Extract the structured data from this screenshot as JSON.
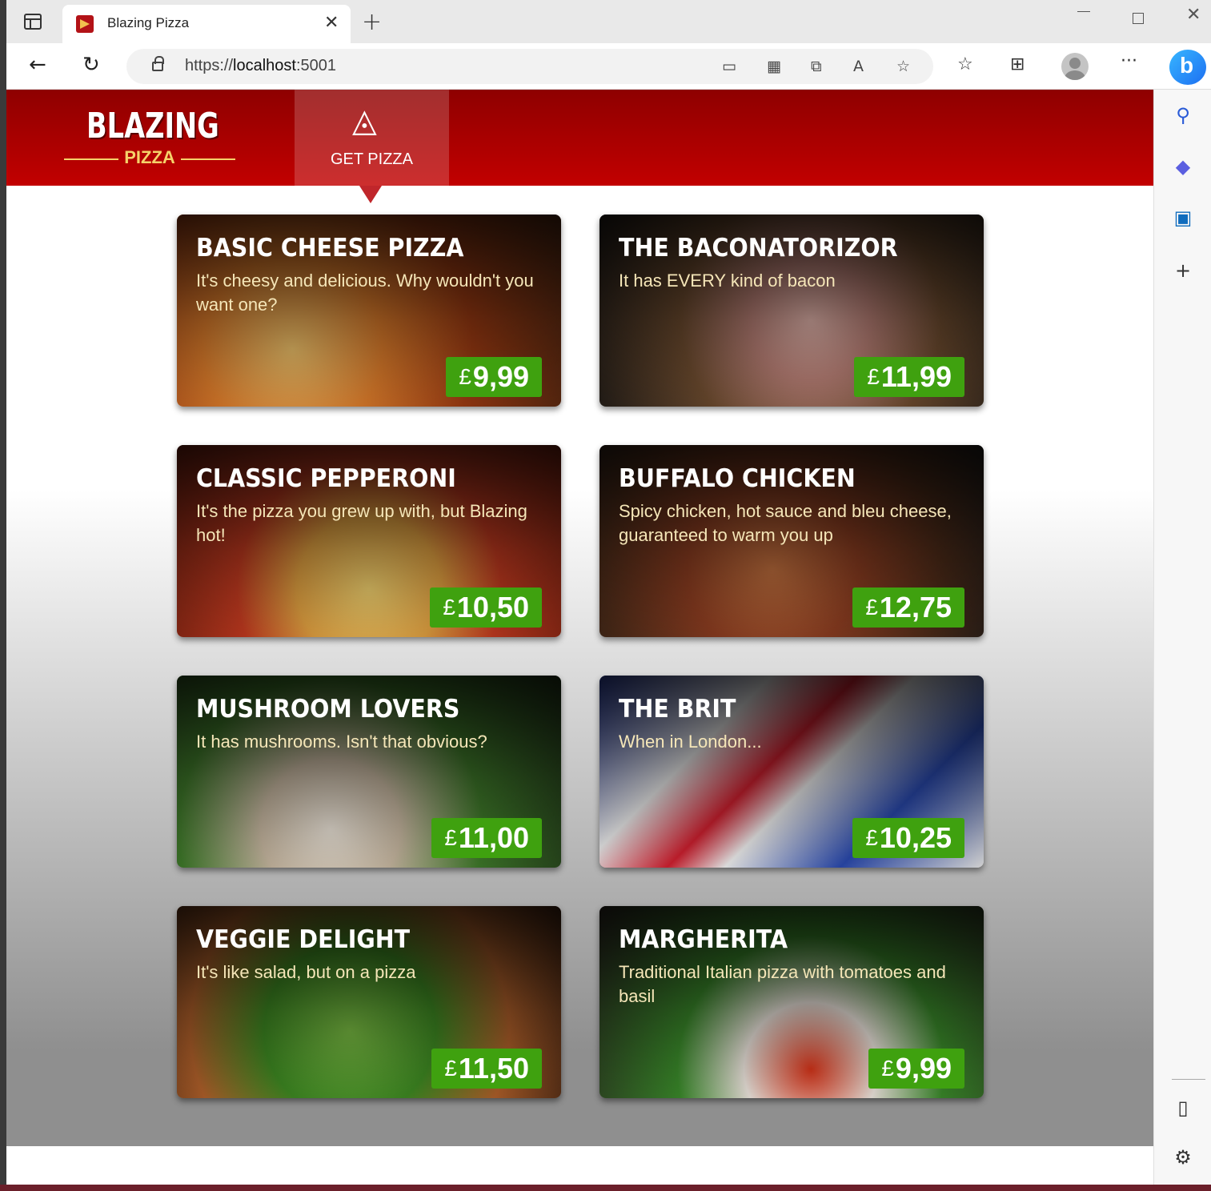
{
  "browser": {
    "tab_title": "Blazing Pizza",
    "url_scheme": "https://",
    "url_host": "localhost",
    "url_port": ":5001"
  },
  "header": {
    "logo_main": "BLAZING",
    "logo_sub": "PIZZA",
    "nav_get_pizza": "GET PIZZA"
  },
  "specials": [
    {
      "name": "BASIC CHEESE PIZZA",
      "description": "It's cheesy and delicious. Why wouldn't you want one?",
      "currency": "£",
      "price": "9,99"
    },
    {
      "name": "THE BACONATORIZOR",
      "description": "It has EVERY kind of bacon",
      "currency": "£",
      "price": "11,99"
    },
    {
      "name": "CLASSIC PEPPERONI",
      "description": "It's the pizza you grew up with, but Blazing hot!",
      "currency": "£",
      "price": "10,50"
    },
    {
      "name": "BUFFALO CHICKEN",
      "description": "Spicy chicken, hot sauce and bleu cheese, guaranteed to warm you up",
      "currency": "£",
      "price": "12,75"
    },
    {
      "name": "MUSHROOM LOVERS",
      "description": "It has mushrooms. Isn't that obvious?",
      "currency": "£",
      "price": "11,00"
    },
    {
      "name": "THE BRIT",
      "description": "When in London...",
      "currency": "£",
      "price": "10,25"
    },
    {
      "name": "VEGGIE DELIGHT",
      "description": "It's like salad, but on a pizza",
      "currency": "£",
      "price": "11,50"
    },
    {
      "name": "MARGHERITA",
      "description": "Traditional Italian pizza with tomatoes and basil",
      "currency": "£",
      "price": "9,99"
    }
  ],
  "colors": {
    "header_red": "#b30000",
    "price_green": "#3fa10f",
    "logo_gold": "#f5d26a"
  }
}
